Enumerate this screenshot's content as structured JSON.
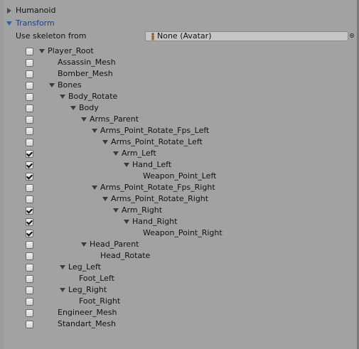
{
  "sections": {
    "humanoid": "Humanoid",
    "transform": "Transform"
  },
  "skeleton": {
    "label": "Use skeleton from",
    "value": "None (Avatar)"
  },
  "tree": [
    {
      "name": "Player_Root",
      "checked": false,
      "foldout": true
    },
    {
      "name": "Assassin_Mesh",
      "checked": false,
      "foldout": false
    },
    {
      "name": "Bomber_Mesh",
      "checked": false,
      "foldout": false
    },
    {
      "name": "Bones",
      "checked": false,
      "foldout": true
    },
    {
      "name": "Body_Rotate",
      "checked": false,
      "foldout": true
    },
    {
      "name": "Body",
      "checked": false,
      "foldout": true
    },
    {
      "name": "Arms_Parent",
      "checked": false,
      "foldout": true
    },
    {
      "name": "Arms_Point_Rotate_Fps_Left",
      "checked": false,
      "foldout": true
    },
    {
      "name": "Arms_Point_Rotate_Left",
      "checked": false,
      "foldout": true
    },
    {
      "name": "Arm_Left",
      "checked": true,
      "foldout": true
    },
    {
      "name": "Hand_Left",
      "checked": true,
      "foldout": true
    },
    {
      "name": "Weapon_Point_Left",
      "checked": true,
      "foldout": false
    },
    {
      "name": "Arms_Point_Rotate_Fps_Right",
      "checked": false,
      "foldout": true
    },
    {
      "name": "Arms_Point_Rotate_Right",
      "checked": false,
      "foldout": true
    },
    {
      "name": "Arm_Right",
      "checked": true,
      "foldout": true
    },
    {
      "name": "Hand_Right",
      "checked": true,
      "foldout": true
    },
    {
      "name": "Weapon_Point_Right",
      "checked": true,
      "foldout": false
    },
    {
      "name": "Head_Parent",
      "checked": false,
      "foldout": true
    },
    {
      "name": "Head_Rotate",
      "checked": false,
      "foldout": false
    },
    {
      "name": "Leg_Left",
      "checked": false,
      "foldout": true
    },
    {
      "name": "Foot_Left",
      "checked": false,
      "foldout": false
    },
    {
      "name": "Leg_Right",
      "checked": false,
      "foldout": true
    },
    {
      "name": "Foot_Right",
      "checked": false,
      "foldout": false
    },
    {
      "name": "Engineer_Mesh",
      "checked": false,
      "foldout": false
    },
    {
      "name": "Standart_Mesh",
      "checked": false,
      "foldout": false
    }
  ],
  "colors": {
    "background": "#a2a2a2",
    "active_section": "#1c3f8f"
  }
}
